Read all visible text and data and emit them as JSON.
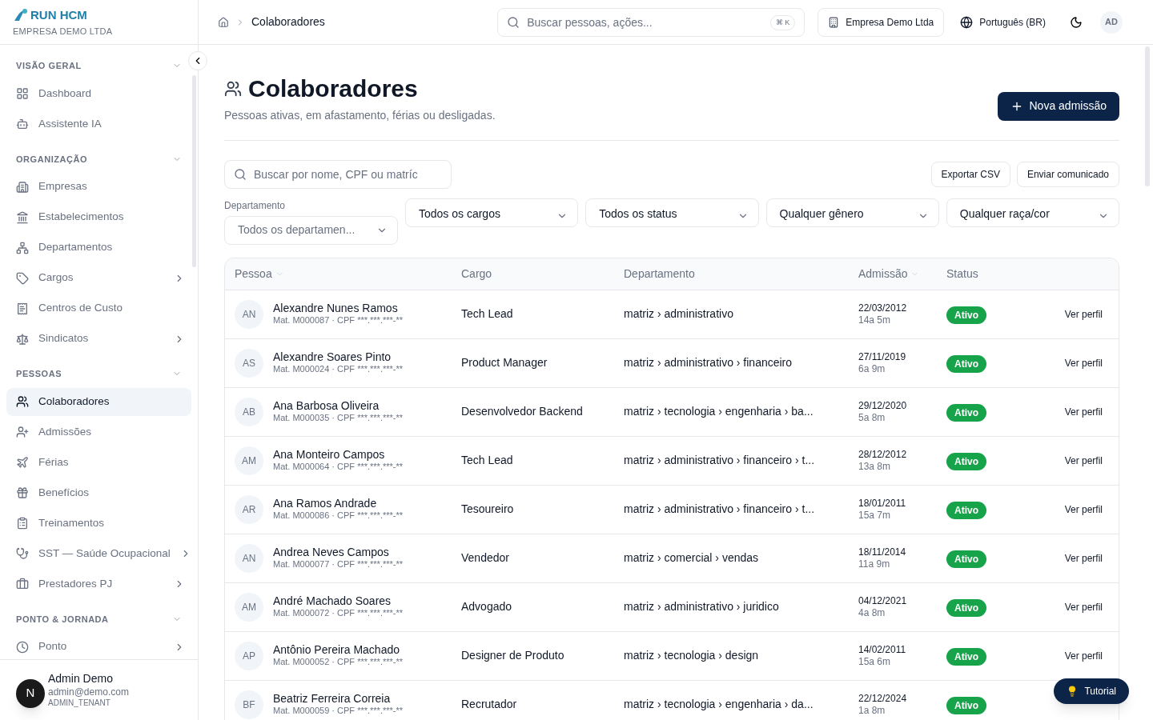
{
  "brand": {
    "logo": "RUN HCM",
    "company": "EMPRESA DEMO LTDA"
  },
  "sidebar": {
    "sections": [
      {
        "title": "VISÃO GERAL",
        "expanded": true,
        "items": [
          {
            "label": "Dashboard",
            "selected": false,
            "has_submenu": false
          },
          {
            "label": "Assistente IA",
            "selected": false,
            "has_submenu": false
          }
        ]
      },
      {
        "title": "ORGANIZAÇÃO",
        "expanded": true,
        "items": [
          {
            "label": "Empresas",
            "selected": false,
            "has_submenu": false
          },
          {
            "label": "Estabelecimentos",
            "selected": false,
            "has_submenu": false
          },
          {
            "label": "Departamentos",
            "selected": false,
            "has_submenu": false
          },
          {
            "label": "Cargos",
            "selected": false,
            "has_submenu": true
          },
          {
            "label": "Centros de Custo",
            "selected": false,
            "has_submenu": false
          },
          {
            "label": "Sindicatos",
            "selected": false,
            "has_submenu": true
          }
        ]
      },
      {
        "title": "PESSOAS",
        "expanded": true,
        "items": [
          {
            "label": "Colaboradores",
            "selected": true,
            "has_submenu": false
          },
          {
            "label": "Admissões",
            "selected": false,
            "has_submenu": false
          },
          {
            "label": "Férias",
            "selected": false,
            "has_submenu": false
          },
          {
            "label": "Benefícios",
            "selected": false,
            "has_submenu": false
          },
          {
            "label": "Treinamentos",
            "selected": false,
            "has_submenu": false
          },
          {
            "label": "SST — Saúde Ocupacional",
            "selected": false,
            "has_submenu": true
          },
          {
            "label": "Prestadores PJ",
            "selected": false,
            "has_submenu": true
          }
        ]
      },
      {
        "title": "PONTO & JORNADA",
        "expanded": true,
        "items": [
          {
            "label": "Ponto",
            "selected": false,
            "has_submenu": true
          }
        ]
      }
    ],
    "user": {
      "avatar": "N",
      "name": "Admin Demo",
      "email": "admin@demo.com",
      "role": "ADMIN_TENANT"
    }
  },
  "topbar": {
    "breadcrumb": "Colaboradores",
    "search": {
      "placeholder": "Buscar pessoas, ações...",
      "shortcut": "⌘ K"
    },
    "company": "Empresa Demo Ltda",
    "language": "Português (BR)",
    "avatar": "AD"
  },
  "page": {
    "title": "Colaboradores",
    "subtitle": "Pessoas ativas, em afastamento, férias ou desligadas.",
    "primary_action": "Nova admissão"
  },
  "toolbar": {
    "search": {
      "placeholder": "Buscar por nome, CPF ou matríc"
    },
    "actions": [
      "Exportar CSV",
      "Enviar comunicado"
    ]
  },
  "filters": [
    {
      "label": "Departamento",
      "value": "Todos os departamen...",
      "muted": true
    },
    {
      "value": "Todos os cargos",
      "muted": false
    },
    {
      "value": "Todos os status",
      "muted": false
    },
    {
      "value": "Qualquer gênero",
      "muted": false
    },
    {
      "value": "Qualquer raça/cor",
      "muted": false
    }
  ],
  "table": {
    "columns": [
      {
        "label": "Pessoa",
        "sortable": true
      },
      {
        "label": "Cargo",
        "sortable": false
      },
      {
        "label": "Departamento",
        "sortable": false
      },
      {
        "label": "Admissão",
        "sortable": true
      },
      {
        "label": "Status",
        "sortable": false
      }
    ],
    "rows": [
      {
        "initials": "AN",
        "name": "Alexandre Nunes Ramos",
        "meta": "Mat. M000087 · CPF ***.***.***-**",
        "cargo": "Tech Lead",
        "departamento": "matriz › administrativo",
        "admissao": "22/03/2012",
        "tempo": "14a 5m",
        "status": "Ativo",
        "action": "Ver perfil"
      },
      {
        "initials": "AS",
        "name": "Alexandre Soares Pinto",
        "meta": "Mat. M000024 · CPF ***.***.***-**",
        "cargo": "Product Manager",
        "departamento": "matriz › administrativo › financeiro",
        "admissao": "27/11/2019",
        "tempo": "6a 9m",
        "status": "Ativo",
        "action": "Ver perfil"
      },
      {
        "initials": "AB",
        "name": "Ana Barbosa Oliveira",
        "meta": "Mat. M000035 · CPF ***.***.***-**",
        "cargo": "Desenvolvedor Backend",
        "departamento": "matriz › tecnologia › engenharia › ba...",
        "admissao": "29/12/2020",
        "tempo": "5a 8m",
        "status": "Ativo",
        "action": "Ver perfil"
      },
      {
        "initials": "AM",
        "name": "Ana Monteiro Campos",
        "meta": "Mat. M000064 · CPF ***.***.***-**",
        "cargo": "Tech Lead",
        "departamento": "matriz › administrativo › financeiro › t...",
        "admissao": "28/12/2012",
        "tempo": "13a 8m",
        "status": "Ativo",
        "action": "Ver perfil"
      },
      {
        "initials": "AR",
        "name": "Ana Ramos Andrade",
        "meta": "Mat. M000086 · CPF ***.***.***-**",
        "cargo": "Tesoureiro",
        "departamento": "matriz › administrativo › financeiro › t...",
        "admissao": "18/01/2011",
        "tempo": "15a 7m",
        "status": "Ativo",
        "action": "Ver perfil"
      },
      {
        "initials": "AN",
        "name": "Andrea Neves Campos",
        "meta": "Mat. M000077 · CPF ***.***.***-**",
        "cargo": "Vendedor",
        "departamento": "matriz › comercial › vendas",
        "admissao": "18/11/2014",
        "tempo": "11a 9m",
        "status": "Ativo",
        "action": "Ver perfil"
      },
      {
        "initials": "AM",
        "name": "André Machado Soares",
        "meta": "Mat. M000072 · CPF ***.***.***-**",
        "cargo": "Advogado",
        "departamento": "matriz › administrativo › juridico",
        "admissao": "04/12/2021",
        "tempo": "4a 8m",
        "status": "Ativo",
        "action": "Ver perfil"
      },
      {
        "initials": "AP",
        "name": "Antônio Pereira Machado",
        "meta": "Mat. M000052 · CPF ***.***.***-**",
        "cargo": "Designer de Produto",
        "departamento": "matriz › tecnologia › design",
        "admissao": "14/02/2011",
        "tempo": "15a 6m",
        "status": "Ativo",
        "action": "Ver perfil"
      },
      {
        "initials": "BF",
        "name": "Beatriz Ferreira Correia",
        "meta": "Mat. M000059 · CPF ***.***.***-**",
        "cargo": "Recrutador",
        "departamento": "matriz › tecnologia › engenharia › da...",
        "admissao": "22/12/2024",
        "tempo": "1a 8m",
        "status": "Ativo"
      }
    ]
  },
  "tutorial": "Tutorial"
}
